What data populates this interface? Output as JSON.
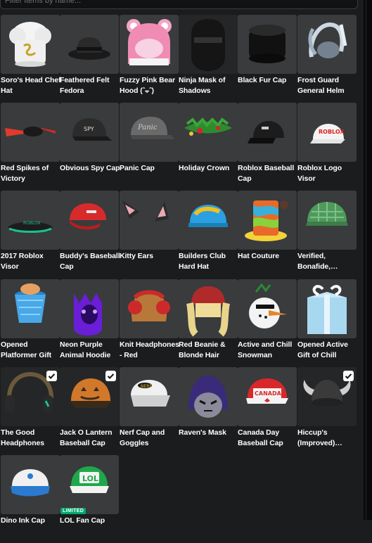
{
  "search": {
    "placeholder": "Filter items by name..."
  },
  "items": [
    {
      "name": "Soro's Head Chef Hat",
      "icon": "chef-hat-icon",
      "checked": false
    },
    {
      "name": "Feathered Felt Fedora",
      "icon": "fedora-icon",
      "checked": false
    },
    {
      "name": "Fuzzy Pink Bear Hood (ˆ⨪ˆ)",
      "icon": "pink-bear-hood-icon",
      "checked": false
    },
    {
      "name": "Ninja Mask of Shadows",
      "icon": "ninja-mask-icon",
      "checked": false
    },
    {
      "name": "Black Fur Cap",
      "icon": "fur-cap-icon",
      "checked": false
    },
    {
      "name": "Frost Guard General Helm",
      "icon": "frost-helm-icon",
      "checked": false
    },
    {
      "name": "Red Spikes of Victory",
      "icon": "red-spikes-icon",
      "checked": false
    },
    {
      "name": "Obvious Spy Cap",
      "icon": "spy-cap-icon",
      "checked": false
    },
    {
      "name": "Panic Cap",
      "icon": "panic-cap-icon",
      "checked": false
    },
    {
      "name": "Holiday Crown",
      "icon": "holiday-crown-icon",
      "checked": false
    },
    {
      "name": "Roblox Baseball Cap",
      "icon": "baseball-cap-icon",
      "checked": false
    },
    {
      "name": "Roblox Logo Visor",
      "icon": "logo-visor-icon",
      "checked": false
    },
    {
      "name": "2017 Roblox Visor",
      "icon": "visor-2017-icon",
      "checked": false
    },
    {
      "name": "Buddy's Baseball Cap",
      "icon": "red-cap-icon",
      "checked": false
    },
    {
      "name": "Kitty Ears",
      "icon": "kitty-ears-icon",
      "checked": false
    },
    {
      "name": "Builders Club Hard Hat",
      "icon": "hard-hat-icon",
      "checked": false
    },
    {
      "name": "Hat Couture",
      "icon": "hat-couture-icon",
      "checked": false
    },
    {
      "name": "Verified, Bonafide, Plaidafied",
      "icon": "plaid-cap-icon",
      "checked": false
    },
    {
      "name": "Opened Platformer Gift",
      "icon": "platformer-gift-icon",
      "checked": false
    },
    {
      "name": "Neon Purple Animal Hoodie",
      "icon": "purple-hoodie-icon",
      "checked": false
    },
    {
      "name": "Knit Headphones - Red",
      "icon": "knit-headphones-icon",
      "checked": false
    },
    {
      "name": "Red Beanie & Blonde Hair",
      "icon": "beanie-hair-icon",
      "checked": false
    },
    {
      "name": "Active and Chill Snowman",
      "icon": "snowman-icon",
      "checked": false
    },
    {
      "name": "Opened Active Gift of Chill",
      "icon": "gift-of-chill-icon",
      "checked": false
    },
    {
      "name": "The Good Headphones",
      "icon": "headphones-icon",
      "checked": true
    },
    {
      "name": "Jack O Lantern Baseball Cap",
      "icon": "pumpkin-cap-icon",
      "checked": true
    },
    {
      "name": "Nerf Cap and Goggles",
      "icon": "nerf-cap-icon",
      "checked": false
    },
    {
      "name": "Raven's Mask",
      "icon": "raven-mask-icon",
      "checked": false
    },
    {
      "name": "Canada Day Baseball Cap",
      "icon": "canada-cap-icon",
      "checked": false
    },
    {
      "name": "Hiccup's (Improved) Helmet",
      "icon": "viking-helmet-icon",
      "checked": true
    },
    {
      "name": "Dino Ink Cap",
      "icon": "blue-cap-icon",
      "checked": false
    },
    {
      "name": "LOL Fan Cap",
      "icon": "lol-cap-icon",
      "checked": false,
      "badge": "LIMITED"
    }
  ],
  "colors": {
    "background": "#1b1c1e",
    "tile": "#393b3d",
    "limited": "#00a86b"
  }
}
